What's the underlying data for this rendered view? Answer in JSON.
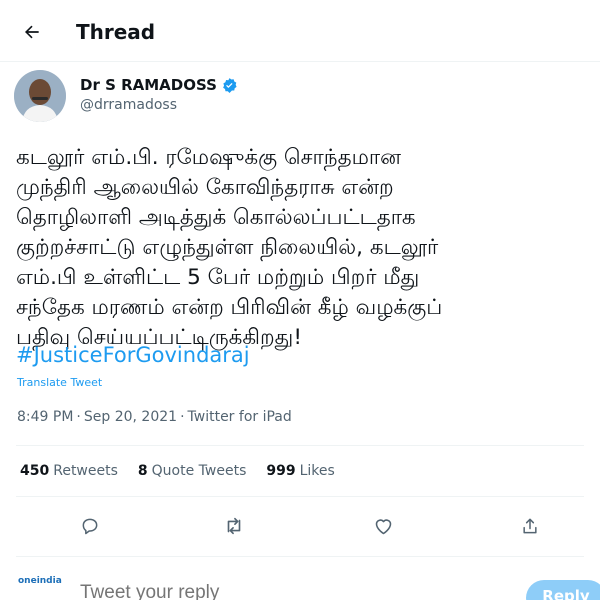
{
  "header": {
    "title": "Thread",
    "back_icon": "arrow-left-icon"
  },
  "author": {
    "display_name": "Dr S RAMADOSS",
    "handle": "@drramadoss",
    "verified_icon": "verified-badge-icon",
    "verified_color": "#1d9bf0"
  },
  "tweet": {
    "lines": [
      "கடலூர் எம்.பி.  ரமேஷுக்கு சொந்தமான",
      "முந்திரி ஆலையில் கோவிந்தராசு என்ற",
      "தொழிலாளி அடித்துக் கொல்லப்பட்டதாக",
      "குற்றச்சாட்டு எழுந்துள்ள நிலையில், கடலூர்",
      "எம்.பி உள்ளிட்ட 5 பேர் மற்றும் பிறர் மீது",
      "சந்தேக மரணம்  என்ற பிரிவின் கீழ் வழக்குப்",
      "பதிவு செய்யப்பட்டிருக்கிறது!"
    ],
    "hashtag": "#JusticeForGovindaraj",
    "translate_label": "Translate Tweet",
    "time": "8:49 PM",
    "date": "Sep 20, 2021",
    "source": "Twitter for iPad"
  },
  "stats": {
    "retweets_count": "450",
    "retweets_label": "Retweets",
    "quotes_count": "8",
    "quotes_label": "Quote Tweets",
    "likes_count": "999",
    "likes_label": "Likes"
  },
  "actions": [
    "reply-icon",
    "retweet-icon",
    "like-icon",
    "share-icon"
  ],
  "reply_box": {
    "avatar_text": "oneindia",
    "placeholder": "Tweet your reply",
    "button_label": "Reply"
  },
  "colors": {
    "accent": "#1d9bf0",
    "muted": "#536471",
    "text": "#0f1419"
  }
}
